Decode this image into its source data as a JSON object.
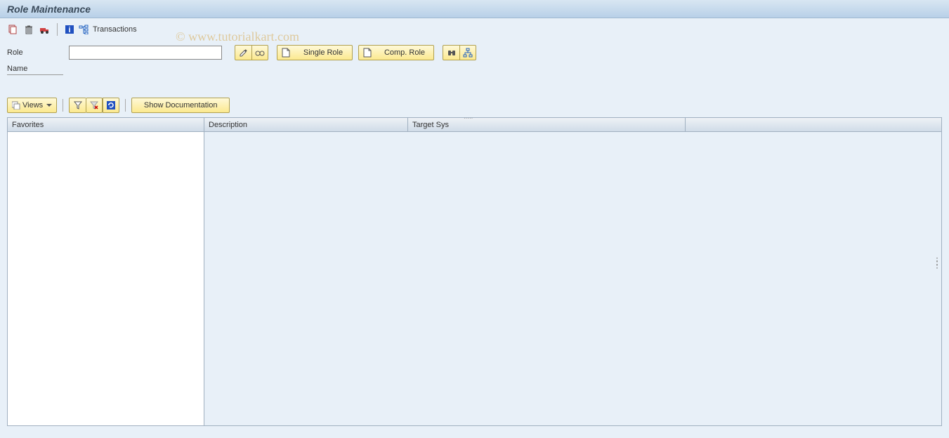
{
  "header": {
    "title": "Role Maintenance"
  },
  "toolbar": {
    "transactions_label": "Transactions"
  },
  "form": {
    "role_label": "Role",
    "role_value": "",
    "name_label": "Name",
    "single_role_label": "Single Role",
    "comp_role_label": "Comp. Role"
  },
  "toolbar2": {
    "views_label": "Views",
    "show_doc_label": "Show Documentation"
  },
  "table": {
    "columns": {
      "favorites": "Favorites",
      "description": "Description",
      "target_sys": "Target Sys"
    }
  },
  "watermark": "© www.tutorialkart.com"
}
